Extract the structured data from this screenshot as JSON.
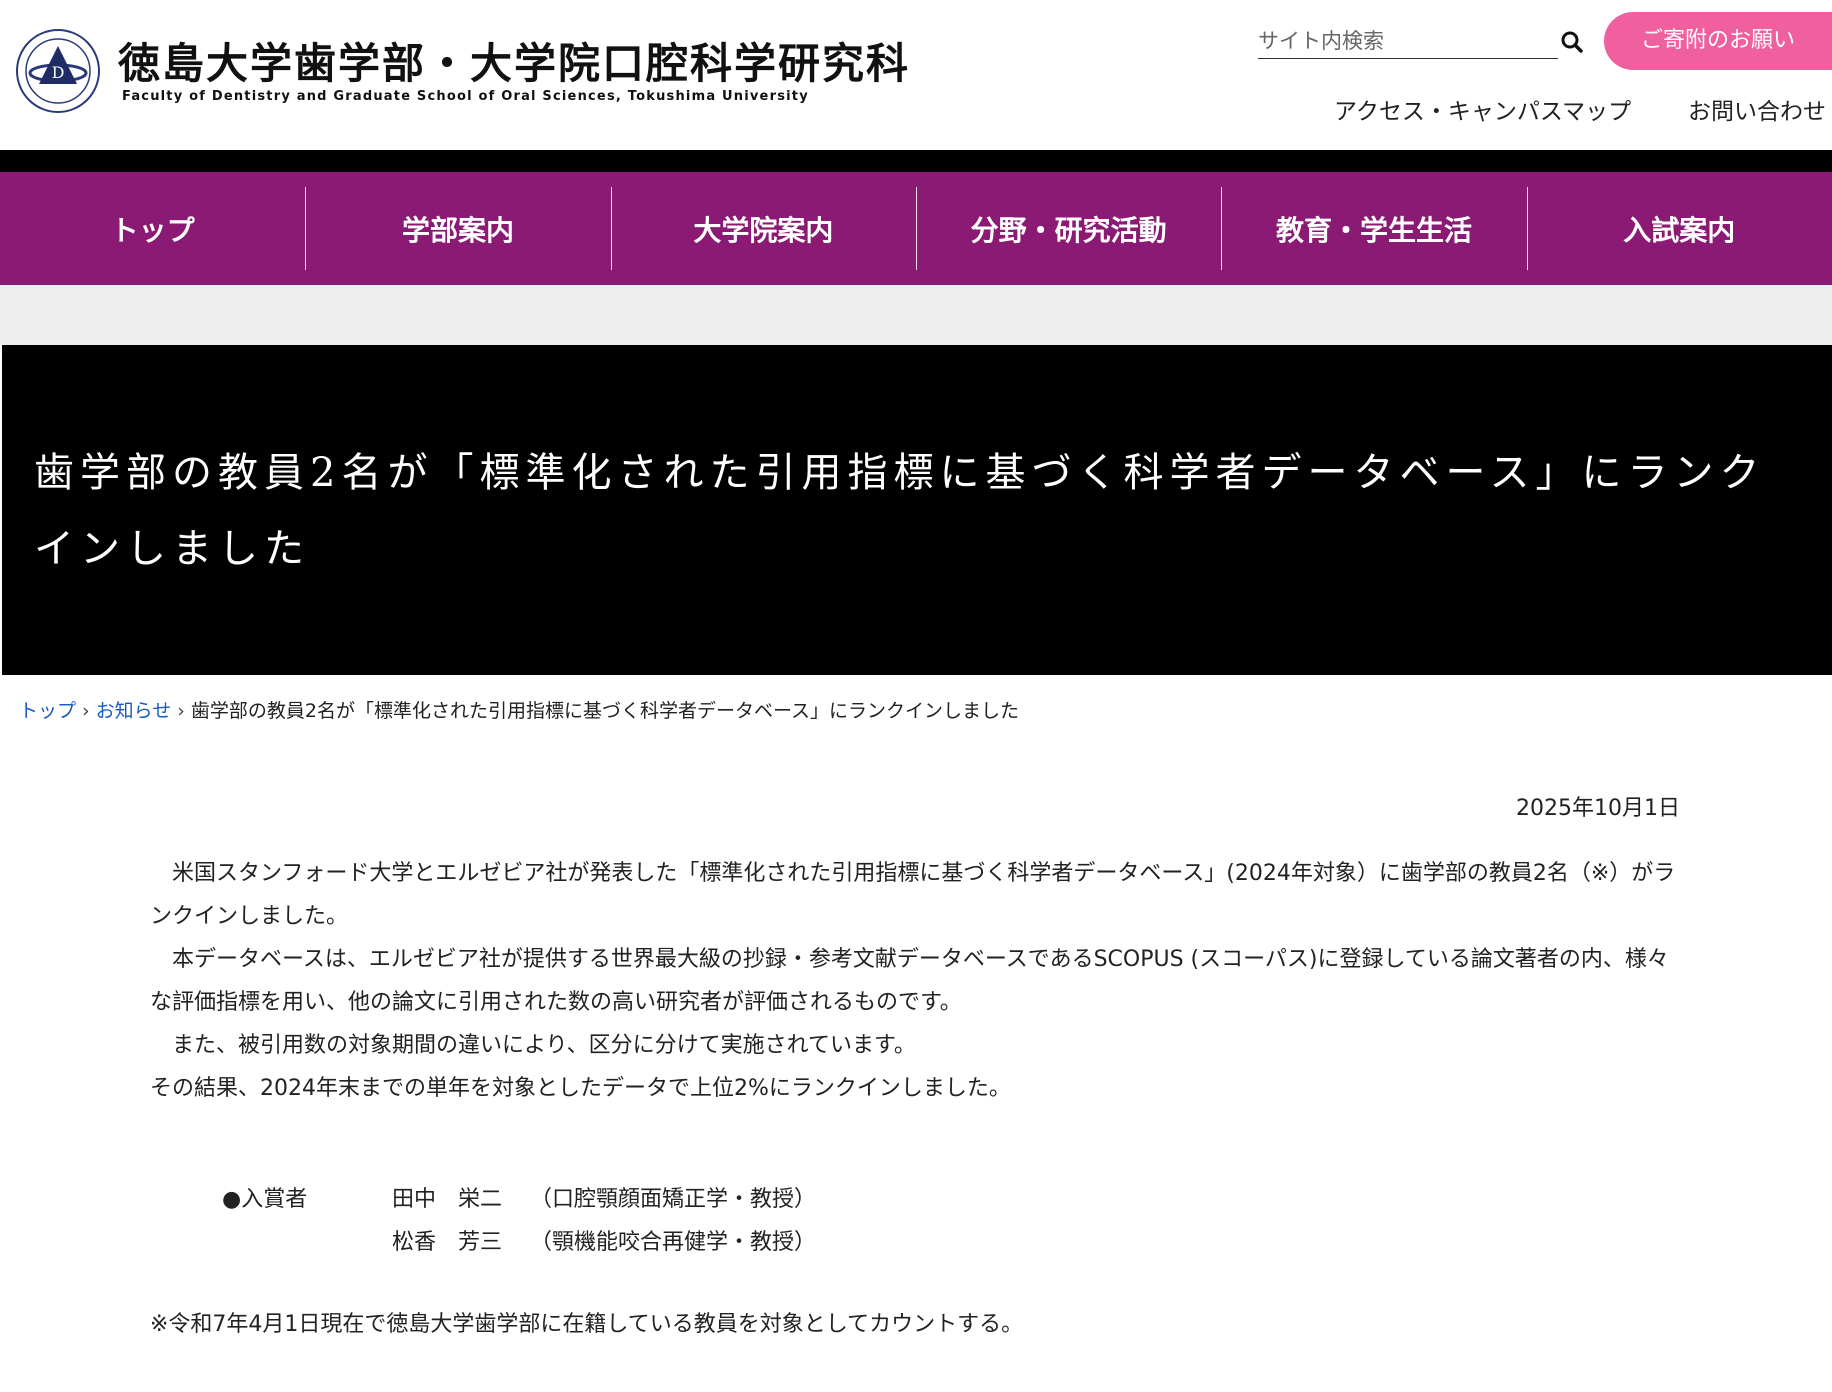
{
  "header": {
    "title": "徳島大学歯学部・大学院口腔科学研究科",
    "subtitle": "Faculty of Dentistry and Graduate School of Oral Sciences, Tokushima University",
    "search_placeholder": "サイト内検索",
    "donate_label": "ご寄附のお願い",
    "links": [
      "アクセス・キャンパスマップ",
      "お問い合わせ"
    ]
  },
  "nav": {
    "items": [
      "トップ",
      "学部案内",
      "大学院案内",
      "分野・研究活動",
      "教育・学生生活",
      "入試案内"
    ]
  },
  "hero": {
    "title": "歯学部の教員2名が「標準化された引用指標に基づく科学者データベース」にランクインしました"
  },
  "breadcrumb": {
    "items": [
      "トップ",
      "お知らせ",
      "歯学部の教員2名が「標準化された引用指標に基づく科学者データベース」にランクインしました"
    ],
    "separator": "›"
  },
  "article": {
    "date": "2025年10月1日",
    "paragraphs": [
      "　米国スタンフォード大学とエルゼビア社が発表した「標準化された引用指標に基づく科学者データベース」(2024年対象）に歯学部の教員2名（※）がランクインしました。",
      "　本データベースは、エルゼビア社が提供する世界最大級の抄録・参考文献データベースであるSCOPUS (スコーパス)に登録している論文著者の内、様々な評価指標を用い、他の論文に引用された数の高い研究者が評価されるものです。",
      "　また、被引用数の対象期間の違いにより、区分に分けて実施されています。",
      "その結果、2024年末までの単年を対象としたデータで上位2%にランクインしました。"
    ],
    "winners_label": "●入賞者",
    "winners": [
      {
        "name": "田中　栄二",
        "dept": "（口腔顎顔面矯正学・教授）"
      },
      {
        "name": "松香　芳三",
        "dept": "（顎機能咬合再健学・教授）"
      }
    ],
    "footnote": "※令和7年4月1日現在で徳島大学歯学部に在籍している教員を対象としてカウントする。"
  },
  "colors": {
    "nav_bg": "#8a1a74",
    "donate_bg": "#f0609f",
    "link": "#1a5bbf",
    "hero_bg": "#000000"
  }
}
